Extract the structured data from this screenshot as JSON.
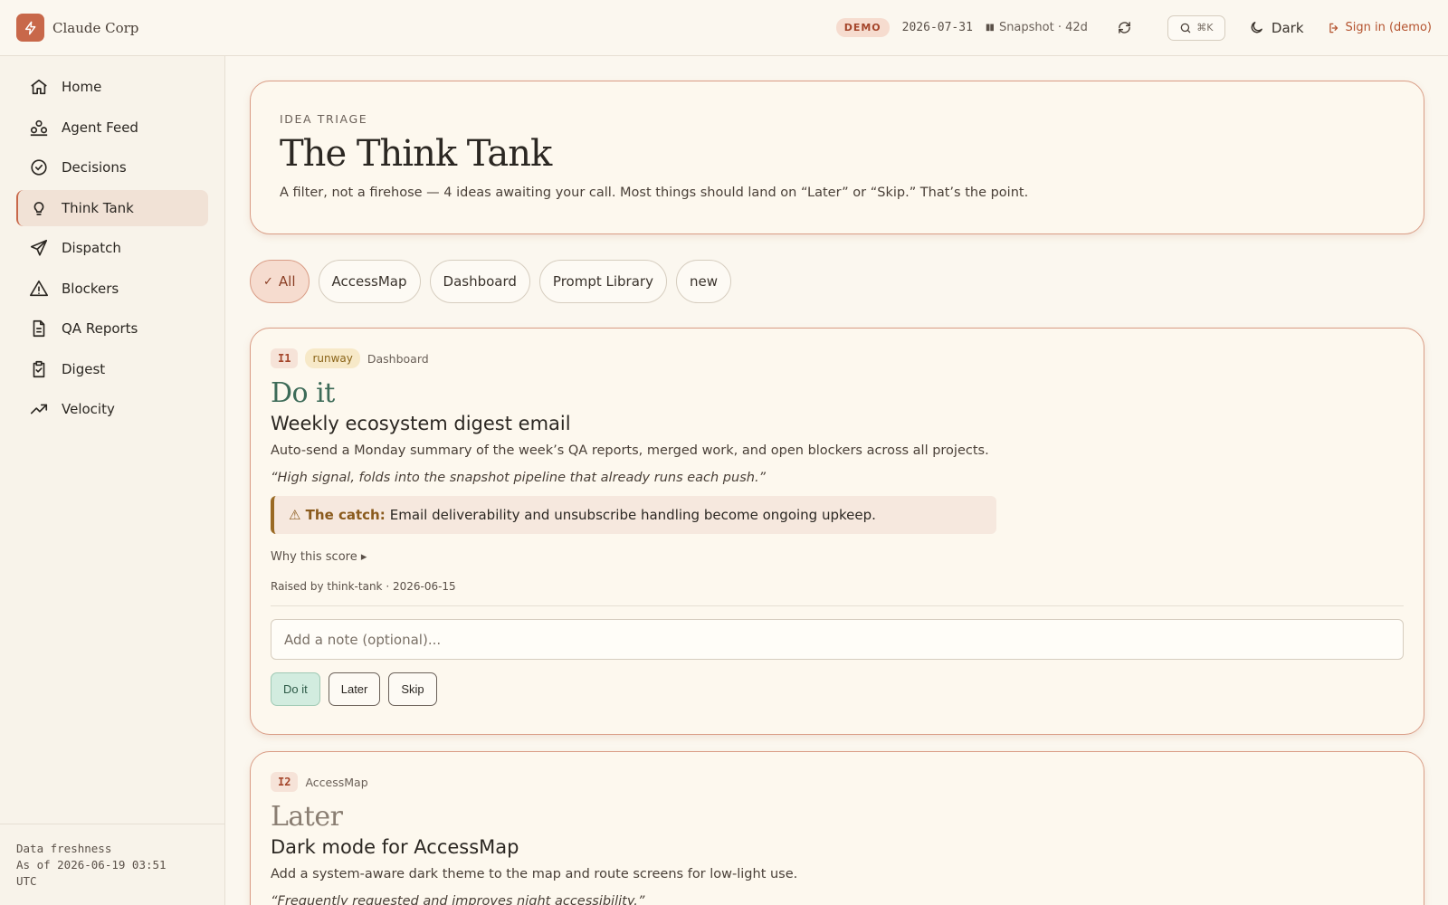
{
  "app": {
    "name": "Claude Corp"
  },
  "topbar": {
    "demo_label": "DEMO",
    "date": "2026-07-31",
    "snapshot": "Snapshot · 42d",
    "search_kbd": "⌘K",
    "theme_label": "Dark",
    "signin_label": "Sign in (demo)"
  },
  "sidebar": {
    "items": [
      {
        "label": "Home",
        "icon": "home-icon"
      },
      {
        "label": "Agent Feed",
        "icon": "agents-icon"
      },
      {
        "label": "Decisions",
        "icon": "check-circle-icon"
      },
      {
        "label": "Think Tank",
        "icon": "lightbulb-icon",
        "active": true
      },
      {
        "label": "Dispatch",
        "icon": "send-icon"
      },
      {
        "label": "Blockers",
        "icon": "warning-icon"
      },
      {
        "label": "QA Reports",
        "icon": "document-icon"
      },
      {
        "label": "Digest",
        "icon": "clipboard-icon"
      },
      {
        "label": "Velocity",
        "icon": "trend-up-icon"
      }
    ],
    "footer": {
      "line1": "Data freshness",
      "line2": "As of 2026-06-19 03:51",
      "line3": "UTC"
    }
  },
  "hero": {
    "eyebrow": "IDEA TRIAGE",
    "title": "The Think Tank",
    "description": "A filter, not a firehose — 4 ideas awaiting your call. Most things should land on “Later” or “Skip.” That’s the point."
  },
  "filters": [
    "All",
    "AccessMap",
    "Dashboard",
    "Prompt Library",
    "new"
  ],
  "cards": [
    {
      "id": "I1",
      "tag": "runway",
      "project": "Dashboard",
      "verdict": "Do it",
      "title": "Weekly ecosystem digest email",
      "description": "Auto-send a Monday summary of the week’s QA reports, merged work, and open blockers across all projects.",
      "quote": "“High signal, folds into the snapshot pipeline that already runs each push.”",
      "catch_label": "⚠ The catch:",
      "catch_text": "Email deliverability and unsubscribe handling become ongoing upkeep.",
      "why": "Why this score ▸",
      "raised": "Raised by think-tank · 2026-06-15",
      "note_placeholder": "Add a note (optional)...",
      "actions": [
        "Do it",
        "Later",
        "Skip"
      ]
    },
    {
      "id": "I2",
      "project": "AccessMap",
      "verdict": "Later",
      "title": "Dark mode for AccessMap",
      "description": "Add a system-aware dark theme to the map and route screens for low-light use.",
      "quote": "“Frequently requested and improves night accessibility.”"
    }
  ],
  "colors": {
    "accent": "#c8684a",
    "do_it": "#3d6b58",
    "background": "#fbf7ef"
  }
}
